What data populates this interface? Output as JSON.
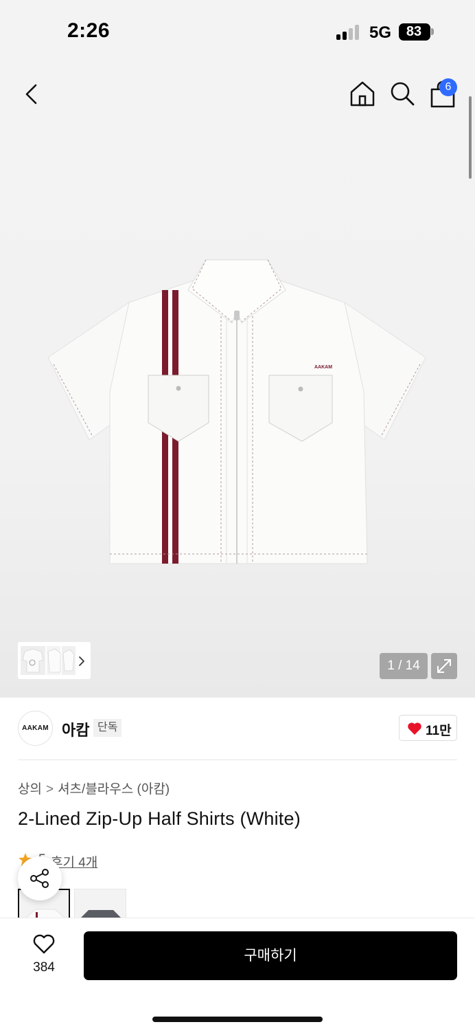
{
  "status_bar": {
    "time": "2:26",
    "network": "5G",
    "battery": "83"
  },
  "nav": {
    "cart_count": "6"
  },
  "gallery": {
    "counter": "1 / 14",
    "thumb_alt": "product thumbnails",
    "shirt_logo": "AAKAM"
  },
  "brand": {
    "logo_text": "AAKAM",
    "name": "아캄",
    "badge": "단독",
    "likes": "11만"
  },
  "breadcrumb": {
    "category": "상의",
    "separator": ">",
    "subcategory": "셔츠/블라우스 (아캄)"
  },
  "product": {
    "title": "2-Lined Zip-Up Half Shirts (White)",
    "rating": "5",
    "reviews": "후기 4개"
  },
  "bottom_bar": {
    "wish_count": "384",
    "buy_label": "구매하기"
  },
  "colors": {
    "accent_stripe": "#7a1c2e",
    "badge_blue": "#2f6bff",
    "heart_red": "#e8132a"
  }
}
